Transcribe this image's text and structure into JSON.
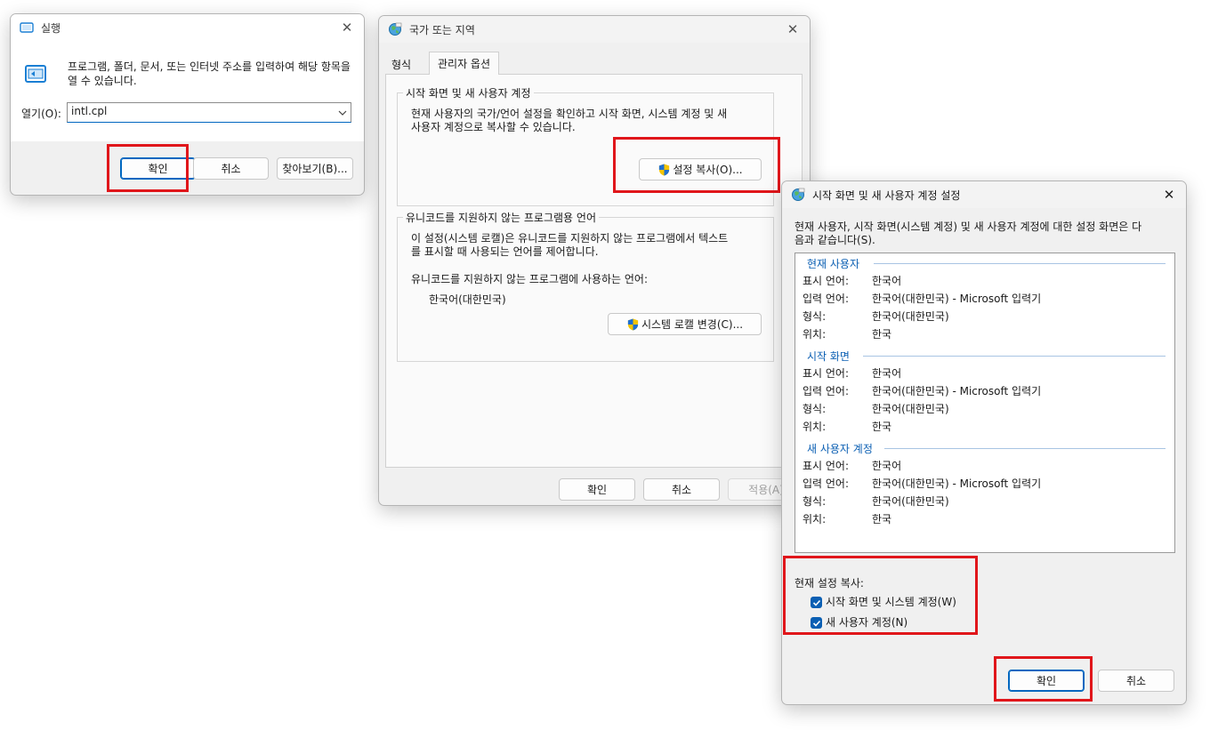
{
  "run_dialog": {
    "title": "실행",
    "description": "프로그램, 폴더, 문서, 또는 인터넷 주소를 입력하여 해당 항목을 열 수 있습니다.",
    "open_label": "열기(O):",
    "open_value": "intl.cpl",
    "ok": "확인",
    "cancel": "취소",
    "browse": "찾아보기(B)...",
    "close": "✕"
  },
  "region_dialog": {
    "title": "국가 또는 지역",
    "tabs": [
      "형식",
      "관리자 옵션"
    ],
    "welcome_group": {
      "label": "시작 화면 및 새 사용자 계정",
      "desc_line1": "현재 사용자의 국가/언어 설정을 확인하고 시작 화면, 시스템 계정 및 새",
      "desc_line2": "사용자 계정으로 복사할 수 있습니다.",
      "copy_button": "설정 복사(O)..."
    },
    "unicode_group": {
      "label": "유니코드를 지원하지 않는 프로그램용 언어",
      "desc_line1": "이 설정(시스템 로캘)은 유니코드를 지원하지 않는 프로그램에서 텍스트",
      "desc_line2": "를 표시할 때 사용되는 언어를 제어합니다.",
      "current_label": "유니코드를 지원하지 않는 프로그램에 사용하는 언어:",
      "current_value": "한국어(대한민국)",
      "change_button": "시스템 로캘 변경(C)..."
    },
    "ok": "확인",
    "cancel": "취소",
    "apply": "적용(A)",
    "close": "✕"
  },
  "settings_dialog": {
    "title": "시작 화면 및 새 사용자 계정 설정",
    "desc_line1": "현재 사용자, 시작 화면(시스템 계정) 및 새 사용자 계정에 대한 설정 화면은 다",
    "desc_line2": "음과 같습니다(S).",
    "sections": [
      {
        "heading": "현재 사용자",
        "rows": [
          {
            "label": "표시 언어:",
            "value": "한국어"
          },
          {
            "label": "입력 언어:",
            "value": "한국어(대한민국) - Microsoft 입력기"
          },
          {
            "label": "형식:",
            "value": "한국어(대한민국)"
          },
          {
            "label": "위치:",
            "value": "한국"
          }
        ]
      },
      {
        "heading": "시작 화면",
        "rows": [
          {
            "label": "표시 언어:",
            "value": "한국어"
          },
          {
            "label": "입력 언어:",
            "value": "한국어(대한민국) - Microsoft 입력기"
          },
          {
            "label": "형식:",
            "value": "한국어(대한민국)"
          },
          {
            "label": "위치:",
            "value": "한국"
          }
        ]
      },
      {
        "heading": "새 사용자 계정",
        "rows": [
          {
            "label": "표시 언어:",
            "value": "한국어"
          },
          {
            "label": "입력 언어:",
            "value": "한국어(대한민국) - Microsoft 입력기"
          },
          {
            "label": "형식:",
            "value": "한국어(대한민국)"
          },
          {
            "label": "위치:",
            "value": "한국"
          }
        ]
      }
    ],
    "copy_label": "현재 설정 복사:",
    "check_welcome": "시작 화면 및 시스템 계정(W)",
    "check_new_user": "새 사용자 계정(N)",
    "ok": "확인",
    "cancel": "취소",
    "close": "✕"
  },
  "colors": {
    "highlight": "#e0161b",
    "accent": "#0067c0",
    "checkbox": "#0b5fb3"
  }
}
